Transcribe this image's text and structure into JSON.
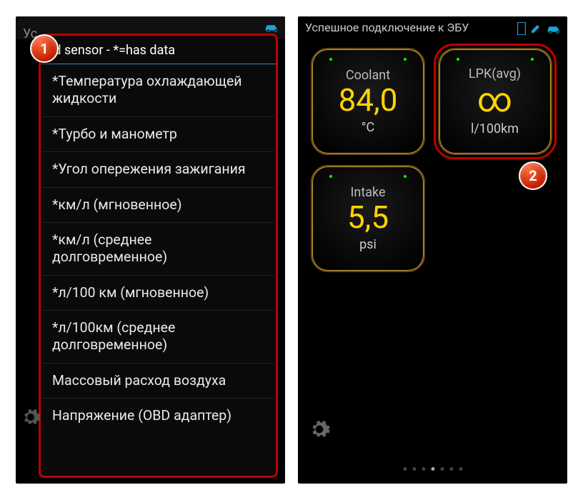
{
  "panel1": {
    "title_cut": "Ус",
    "dialog_title": "ld sensor - *=has data",
    "sensors": [
      "*Температура охлаждающей жидкости",
      "*Турбо и манометр",
      "*Угол опережения зажигания",
      "*км/л (мгновенное)",
      "*км/л (среднее долговременное)",
      "*л/100 км (мгновенное)",
      "*л/100км (среднее долговременное)",
      "Массовый расход воздуха",
      "Напряжение (OBD адаптер)"
    ]
  },
  "panel2": {
    "header": "Успешное подключение к ЭБУ",
    "gauges": {
      "coolant": {
        "label": "Coolant",
        "value": "84,0",
        "unit": "°C"
      },
      "lpk": {
        "label": "LPK(avg)",
        "value": "∞",
        "unit": "l/100km"
      },
      "intake": {
        "label": "Intake",
        "value": "5,5",
        "unit": "psi"
      }
    },
    "pagination": {
      "count": 7,
      "active_index": 3
    }
  },
  "badges": {
    "one": "1",
    "two": "2"
  }
}
